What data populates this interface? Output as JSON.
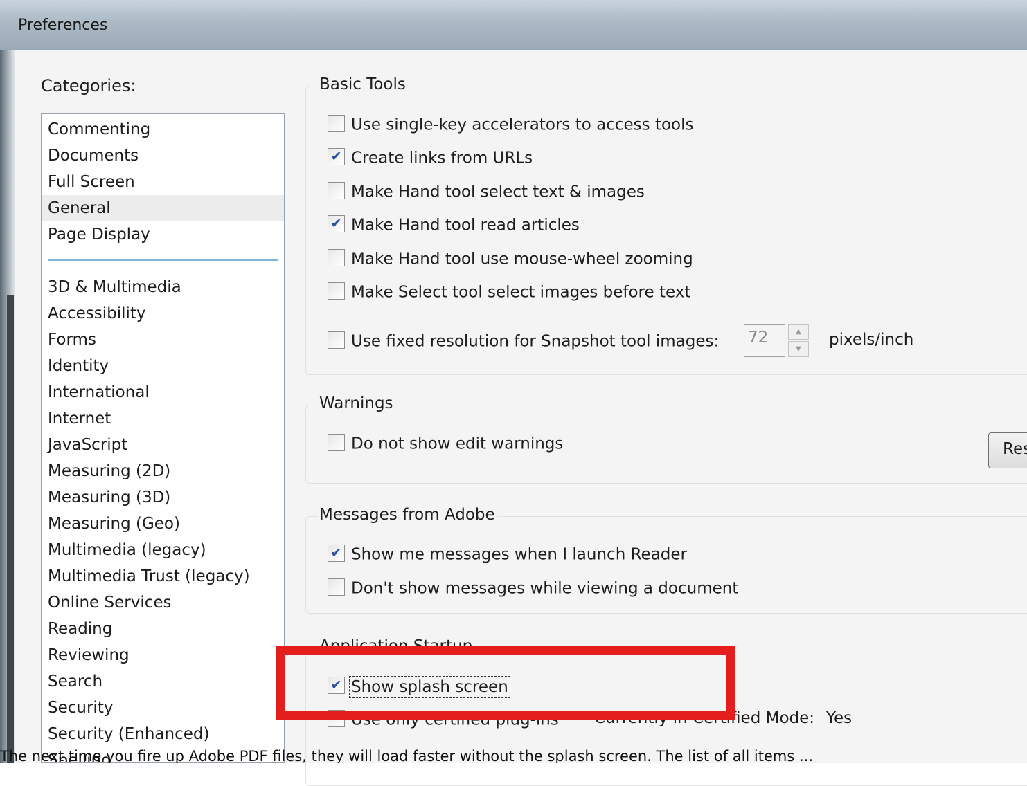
{
  "window": {
    "title": "Preferences"
  },
  "categories": {
    "label": "Categories:",
    "top_items": [
      "Commenting",
      "Documents",
      "Full Screen",
      "General",
      "Page Display"
    ],
    "selected": "General",
    "items": [
      "3D & Multimedia",
      "Accessibility",
      "Forms",
      "Identity",
      "International",
      "Internet",
      "JavaScript",
      "Measuring (2D)",
      "Measuring (3D)",
      "Measuring (Geo)",
      "Multimedia (legacy)",
      "Multimedia Trust (legacy)",
      "Online Services",
      "Reading",
      "Reviewing",
      "Search",
      "Security",
      "Security (Enhanced)",
      "Spelling"
    ]
  },
  "basic_tools": {
    "title": "Basic Tools",
    "options": [
      {
        "label": "Use single-key accelerators to access tools",
        "checked": false
      },
      {
        "label": "Create links from URLs",
        "checked": true
      },
      {
        "label": "Make Hand tool select text & images",
        "checked": false
      },
      {
        "label": "Make Hand tool read articles",
        "checked": true
      },
      {
        "label": "Make Hand tool use mouse-wheel zooming",
        "checked": false
      },
      {
        "label": "Make Select tool select images before text",
        "checked": false
      },
      {
        "label": "Use fixed resolution for Snapshot tool images:",
        "checked": false
      }
    ],
    "resolution_value": "72",
    "resolution_unit": "pixels/inch",
    "spin_up": "▲",
    "spin_down": "▼"
  },
  "warnings": {
    "title": "Warnings",
    "options": [
      {
        "label": "Do not show edit warnings",
        "checked": false
      }
    ],
    "reset_button": "Res"
  },
  "messages": {
    "title": "Messages from Adobe",
    "options": [
      {
        "label": "Show me messages when I launch Reader",
        "checked": true
      },
      {
        "label": "Don't show messages while viewing a document",
        "checked": false
      }
    ]
  },
  "startup": {
    "title": "Application Startup",
    "options": [
      {
        "label": "Show splash screen",
        "checked": true
      },
      {
        "label": "Use only certified plug-ins",
        "checked": false
      }
    ],
    "certified_label": "Currently in Certified Mode:",
    "certified_value": "Yes"
  },
  "caption": "The next time you fire up Adobe PDF files, they will load faster without the splash screen. The list of all items ..."
}
